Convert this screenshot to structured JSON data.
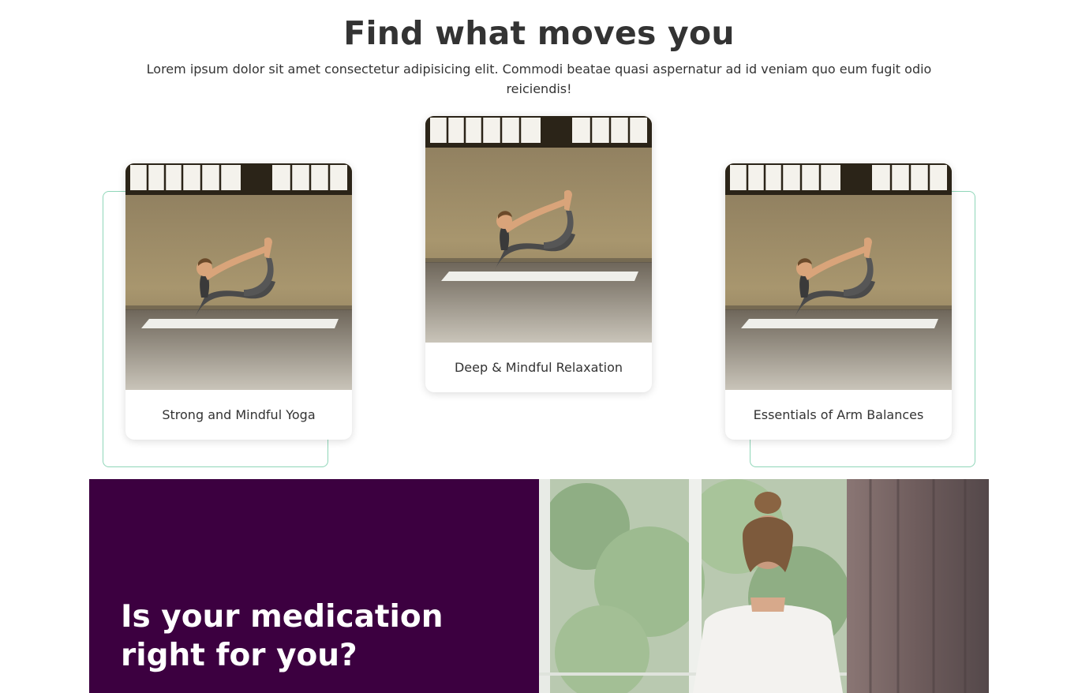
{
  "section": {
    "title": "Find what moves you",
    "description": "Lorem ipsum dolor sit amet consectetur adipisicing elit. Commodi beatae quasi aspernatur ad id veniam quo eum fugit odio reiciendis!"
  },
  "cards": [
    {
      "title": "Strong and Mindful Yoga",
      "image": "yoga-bow-pose-photo"
    },
    {
      "title": "Deep & Mindful Relaxation",
      "image": "yoga-bow-pose-photo"
    },
    {
      "title": "Essentials of Arm Balances",
      "image": "yoga-bow-pose-photo"
    }
  ],
  "banner": {
    "title": "Is your medication right for you?",
    "image": "woman-at-window-photo"
  },
  "colors": {
    "banner_bg": "#3c0040",
    "accent_outline": "#8fd6b8",
    "text": "#333333"
  }
}
